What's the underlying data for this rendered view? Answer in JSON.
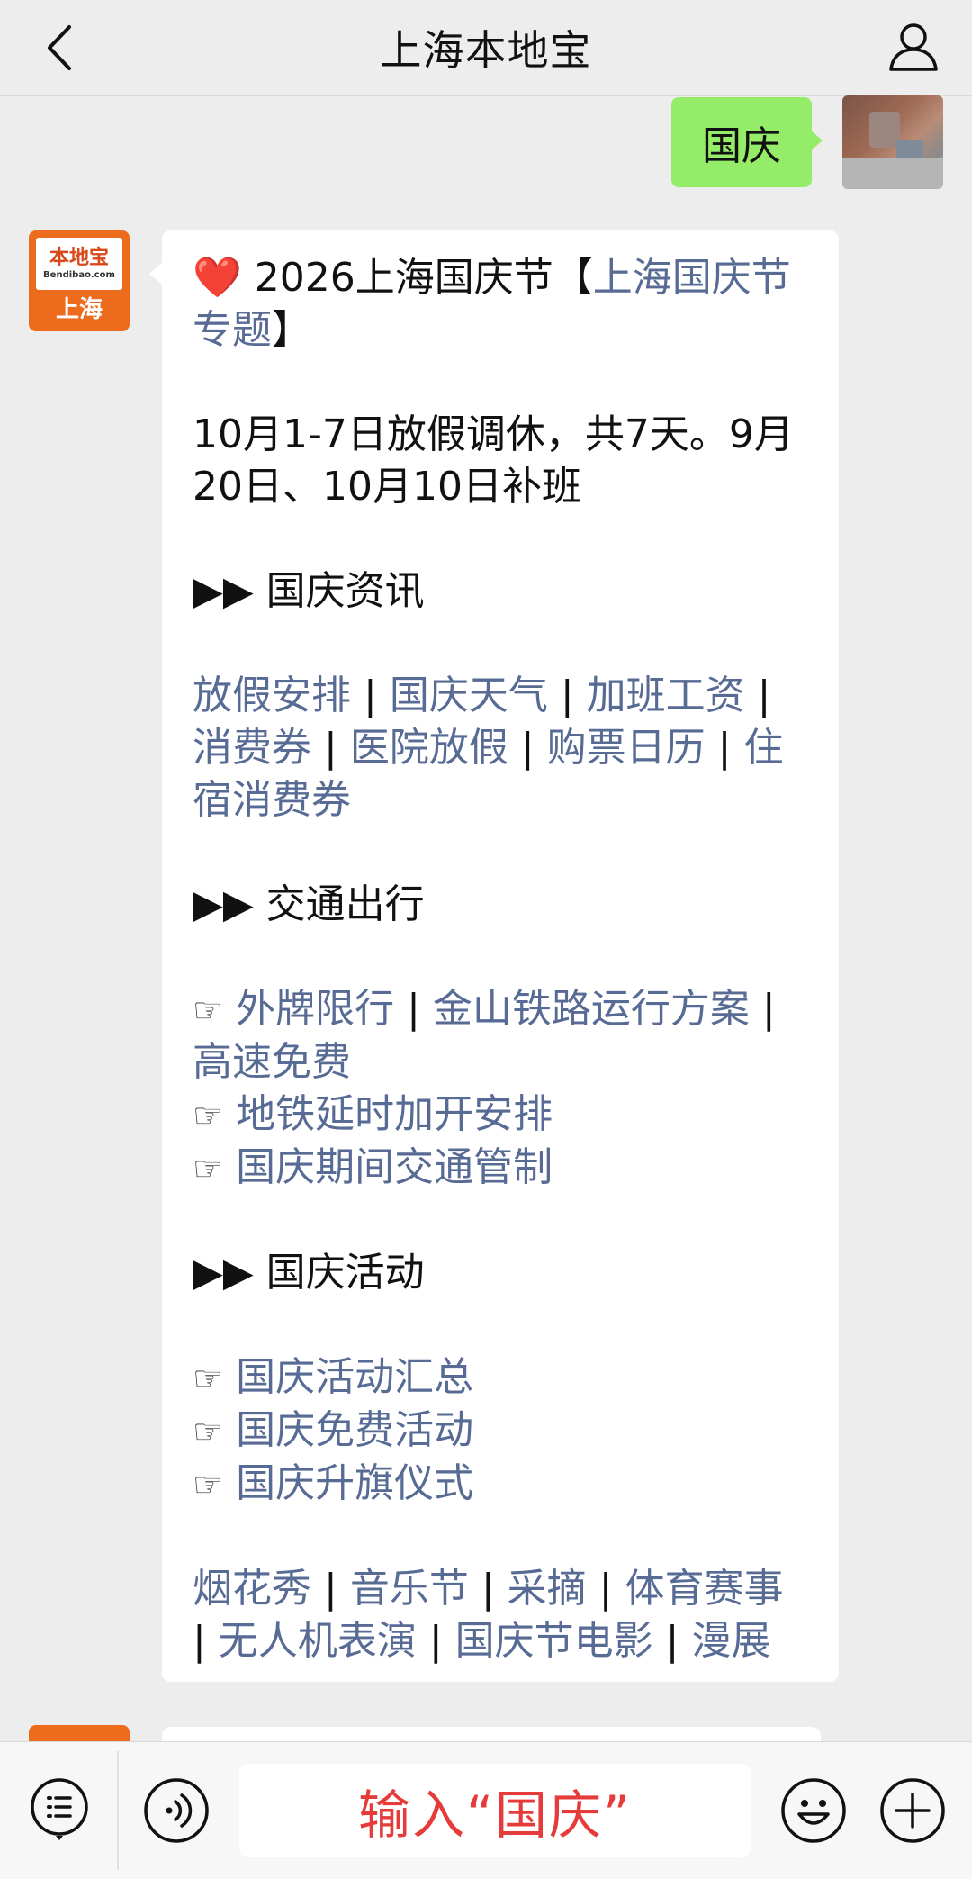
{
  "header": {
    "title": "上海本地宝"
  },
  "sent": {
    "text": "国庆"
  },
  "bot_avatar": {
    "cn": "本地宝",
    "en": "Bendibao.com",
    "city": "上海"
  },
  "message": {
    "intro_heart": "❤️",
    "intro_text": " 2026上海国庆节【",
    "intro_link": "上海国庆节专题",
    "intro_close": "】",
    "dates": "10月1-7日放假调休，共7天。9月20日、10月10日补班",
    "section1_title": "▶▶ 国庆资讯",
    "section1_links": [
      "放假安排",
      "国庆天气",
      "加班工资",
      "消费券",
      "医院放假",
      "购票日历",
      "住宿消费券"
    ],
    "section2_title": "▶▶ 交通出行",
    "pointer": "☞",
    "section2_line1_links": [
      "外牌限行",
      "金山铁路运行方案",
      "高速免费"
    ],
    "section2_line2": "地铁延时加开安排",
    "section2_line3": "国庆期间交通管制",
    "section3_title": "▶▶ 国庆活动",
    "section3_items": [
      "国庆活动汇总",
      "国庆免费活动",
      "国庆升旗仪式"
    ],
    "section4_links": [
      "烟花秀",
      "音乐节",
      "采摘",
      "体育赛事",
      "无人机表演",
      "国庆节电影",
      "漫展"
    ],
    "separator": "|"
  },
  "input": {
    "text": "输入“国庆”"
  },
  "colors": {
    "link": "#576b95",
    "sent_bubble": "#95ec69",
    "input_hint": "#e53b3b",
    "brand": "#ec6b1c"
  }
}
